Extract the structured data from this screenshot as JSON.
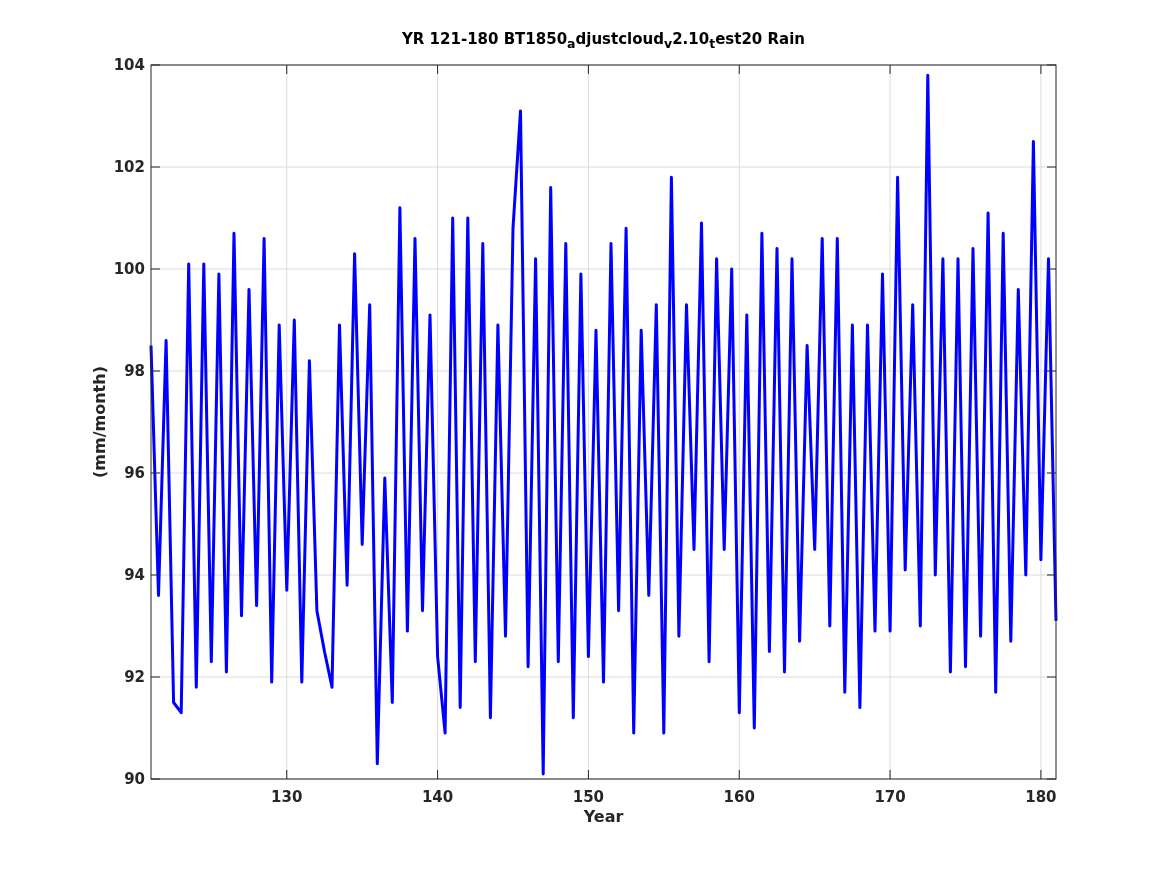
{
  "figure": {
    "chart_data": {
      "type": "line",
      "title": "YR 121-180 BT1850$_{a}$djustcloud$_{v}$2.10$_{t}$est20 Rain",
      "xlabel": "Year",
      "ylabel": "(mm/month)",
      "xlim": [
        121,
        181
      ],
      "ylim": [
        90,
        104
      ],
      "grid": true,
      "xticks": [
        130,
        140,
        150,
        160,
        170,
        180
      ],
      "yticks": [
        90,
        92,
        94,
        96,
        98,
        100,
        102,
        104
      ],
      "x": [
        121,
        121.5,
        122,
        122.5,
        123,
        123.5,
        124,
        124.5,
        125,
        125.5,
        126,
        126.5,
        127,
        127.5,
        128,
        128.5,
        129,
        129.5,
        130,
        130.5,
        131,
        131.5,
        132,
        132.5,
        133,
        133.5,
        134,
        134.5,
        135,
        135.5,
        136,
        136.5,
        137,
        137.5,
        138,
        138.5,
        139,
        139.5,
        140,
        140.5,
        141,
        141.5,
        142,
        142.5,
        143,
        143.5,
        144,
        144.5,
        145,
        145.5,
        146,
        146.5,
        147,
        147.5,
        148,
        148.5,
        149,
        149.5,
        150,
        150.5,
        151,
        151.5,
        152,
        152.5,
        153,
        153.5,
        154,
        154.5,
        155,
        155.5,
        156,
        156.5,
        157,
        157.5,
        158,
        158.5,
        159,
        159.5,
        160,
        160.5,
        161,
        161.5,
        162,
        162.5,
        163,
        163.5,
        164,
        164.5,
        165,
        165.5,
        166,
        166.5,
        167,
        167.5,
        168,
        168.5,
        169,
        169.5,
        170,
        170.5,
        171,
        171.5,
        172,
        172.5,
        173,
        173.5,
        174,
        174.5,
        175,
        175.5,
        176,
        176.5,
        177,
        177.5,
        178,
        178.5,
        179,
        179.5,
        180,
        180.5,
        181
      ],
      "series": [
        {
          "color": "#0000ff",
          "values": [
            98.5,
            93.6,
            98.6,
            91.5,
            91.3,
            100.1,
            91.8,
            100.1,
            92.3,
            99.9,
            92.1,
            100.7,
            93.2,
            99.6,
            93.4,
            100.6,
            91.9,
            98.9,
            93.7,
            99.0,
            91.9,
            98.2,
            93.3,
            92.5,
            91.8,
            98.9,
            93.8,
            100.3,
            94.6,
            99.3,
            90.3,
            95.9,
            91.5,
            101.2,
            92.9,
            100.6,
            93.3,
            99.1,
            92.4,
            90.9,
            101.0,
            91.4,
            101.0,
            92.3,
            100.5,
            91.2,
            98.9,
            92.8,
            100.8,
            103.1,
            92.2,
            100.2,
            90.1,
            101.6,
            92.3,
            100.5,
            91.2,
            99.9,
            92.4,
            98.8,
            91.9,
            100.5,
            93.3,
            100.8,
            90.9,
            98.8,
            93.6,
            99.3,
            90.9,
            101.8,
            92.8,
            99.3,
            94.5,
            100.9,
            92.3,
            100.2,
            94.5,
            100.0,
            91.3,
            99.1,
            91.0,
            100.7,
            92.5,
            100.4,
            92.1,
            100.2,
            92.7,
            98.5,
            94.5,
            100.6,
            93.0,
            100.6,
            91.7,
            98.9,
            91.4,
            98.9,
            92.9,
            99.9,
            92.9,
            101.8,
            94.1,
            99.3,
            93.0,
            103.8,
            94.0,
            100.2,
            92.1,
            100.2,
            92.2,
            100.4,
            92.8,
            101.1,
            91.7,
            100.7,
            92.7,
            99.6,
            94.0,
            102.5,
            94.3,
            100.2,
            93.1
          ]
        }
      ]
    }
  }
}
